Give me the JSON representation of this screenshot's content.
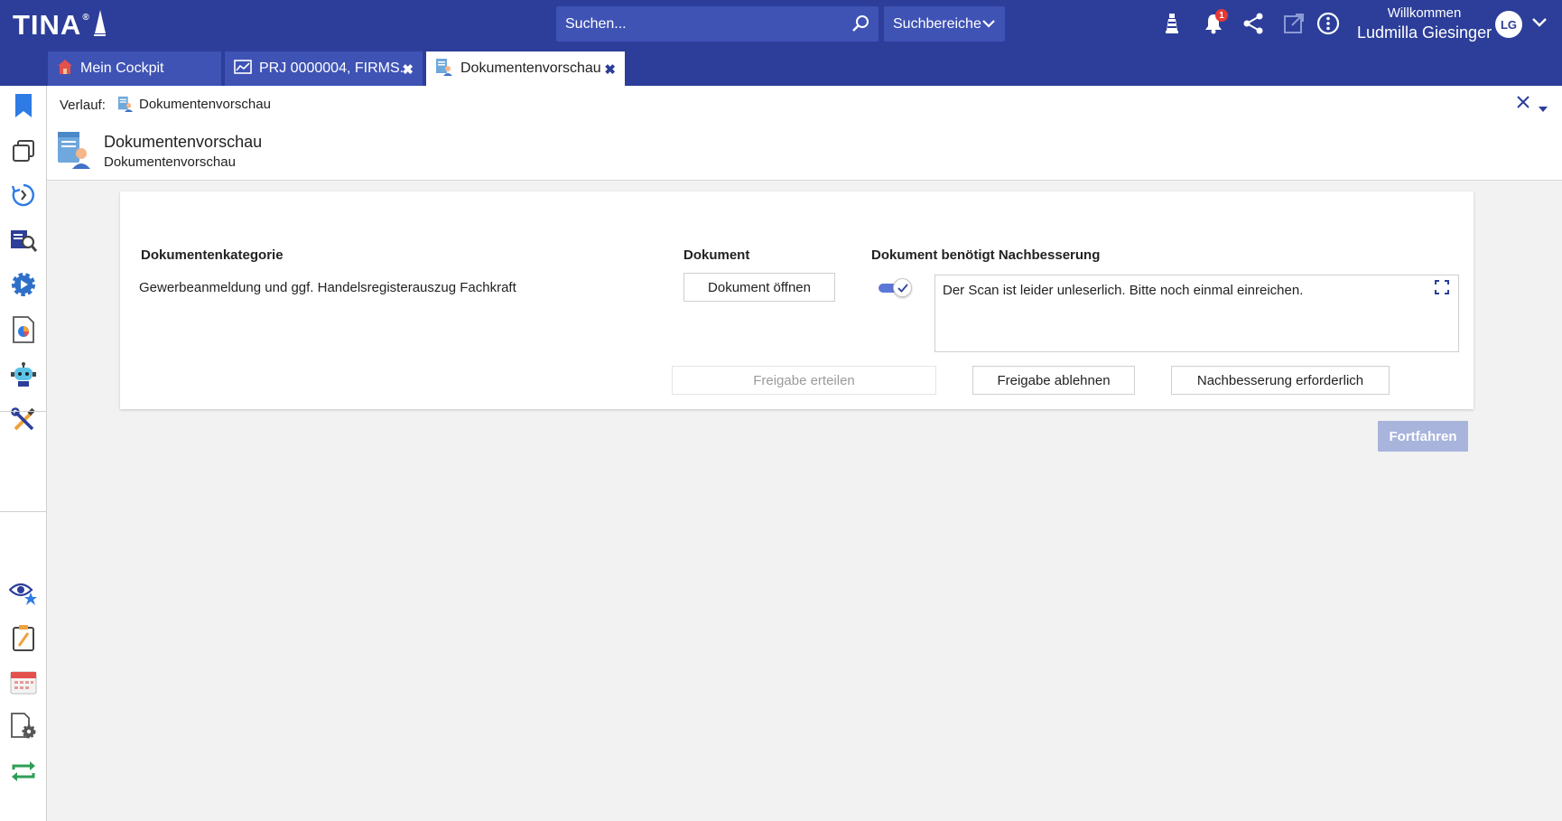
{
  "app": {
    "logo_text": "TINA",
    "logo_reg": "®"
  },
  "topbar": {
    "search_placeholder": "Suchen...",
    "search_areas_label": "Suchbereiche",
    "notification_count": "1",
    "welcome_label": "Willkommen",
    "user_name": "Ludmilla Giesinger",
    "avatar_initials": "LG"
  },
  "tabs": [
    {
      "label": "Mein Cockpit",
      "icon": "home-icon",
      "active": false,
      "closable": false
    },
    {
      "label": "PRJ 0000004, FIRMS...",
      "icon": "chart-card-icon",
      "active": false,
      "closable": true
    },
    {
      "label": "Dokumentenvorschau",
      "icon": "document-user-icon",
      "active": true,
      "closable": true
    }
  ],
  "tab_close_glyph": "✖",
  "breadcrumb": {
    "label": "Verlauf:",
    "item": "Dokumentenvorschau"
  },
  "page": {
    "title": "Dokumentenvorschau",
    "subtitle": "Dokumentenvorschau"
  },
  "table": {
    "col_category": "Dokumentenkategorie",
    "col_document": "Dokument",
    "col_fix": "Dokument benötigt Nachbesserung",
    "category_value": "Gewerbeanmeldung und ggf. Handelsregisterauszug Fachkraft",
    "open_button": "Dokument öffnen",
    "fix_toggle_on": true,
    "comment": "Der Scan ist leider unleserlich. Bitte noch einmal einreichen."
  },
  "actions": {
    "approve": "Freigabe erteilen",
    "reject": "Freigabe ablehnen",
    "needs_fix": "Nachbesserung erforderlich",
    "continue": "Fortfahren"
  },
  "colors": {
    "topbar": "#2c3e99",
    "accent": "#3f53b5",
    "toggle": "#5c78d6",
    "continue_disabled": "#a8b4dc"
  },
  "sidebar_icons": [
    "bookmark-icon",
    "windows-icon",
    "history-icon",
    "document-search-icon",
    "settings-gear-icon",
    "report-chart-icon",
    "robot-icon",
    "tools-icon",
    "watchlist-eye-icon",
    "clipboard-edit-icon",
    "calendar-icon",
    "document-settings-icon",
    "sync-arrows-icon"
  ]
}
